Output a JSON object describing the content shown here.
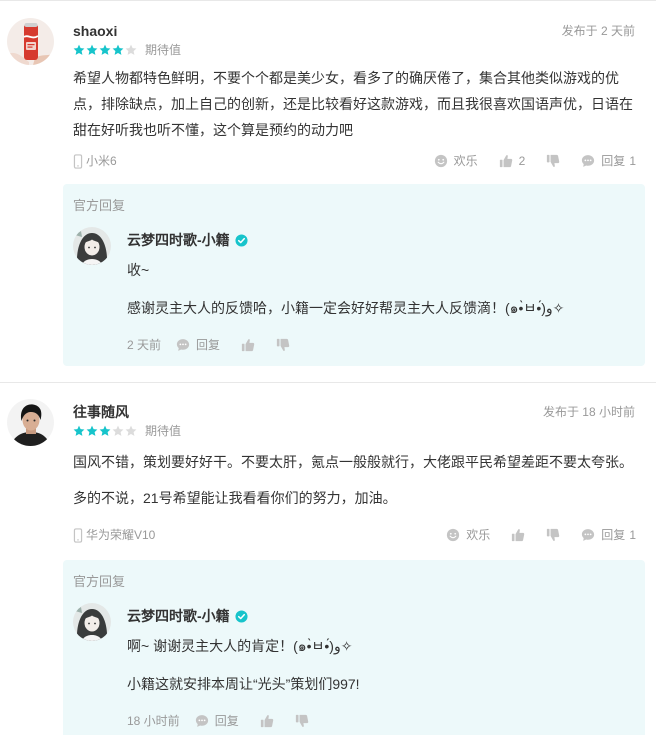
{
  "colors": {
    "accent": "#17c4cb",
    "star_empty": "#dcdcdc",
    "text": "#333333",
    "muted": "#999999",
    "icon": "#c4c4c4",
    "reply_bg": "#edf9fa",
    "divider": "#e8e8e8"
  },
  "icons": {
    "fun": "smile-icon",
    "like": "thumbs-up-icon",
    "dislike": "thumbs-down-icon",
    "reply": "comment-icon",
    "device": "phone-icon",
    "verified": "verified-icon",
    "rating": "star-icon"
  },
  "reviews": [
    {
      "username": "shaoxi",
      "rating": 4,
      "rating_max": 5,
      "rating_label": "期待值",
      "posted": "发布于 2 天前",
      "body": [
        "希望人物都特色鲜明，不要个个都是美少女，看多了的确厌倦了，集合其他类似游戏的优点，排除缺点，加上自己的创新，还是比较看好这款游戏，而且我很喜欢国语声优，日语在甜在好听我也听不懂，这个算是预约的动力吧"
      ],
      "device": "小米6",
      "actions": {
        "fun": "欢乐",
        "likes": "2",
        "reply": "回复",
        "reply_count": "1"
      },
      "official_reply": {
        "header": "官方回复",
        "name": "云梦四时歌-小籍",
        "verified": true,
        "body": [
          "收~",
          "感谢灵主大人的反馈哈，小籍一定会好好帮灵主大人反馈滴！(๑•̀ㅂ•́)و✧"
        ],
        "time": "2 天前",
        "reply": "回复"
      }
    },
    {
      "username": "往事随风",
      "rating": 3,
      "rating_max": 5,
      "rating_label": "期待值",
      "posted": "发布于 18 小时前",
      "body": [
        "国风不错，策划要好好干。不要太肝，氪点一般般就行，大佬跟平民希望差距不要太夸张。",
        "多的不说，21号希望能让我看看你们的努力，加油。"
      ],
      "device": "华为荣耀V10",
      "actions": {
        "fun": "欢乐",
        "reply": "回复",
        "reply_count": "1"
      },
      "official_reply": {
        "header": "官方回复",
        "name": "云梦四时歌-小籍",
        "verified": true,
        "body": [
          "啊~ 谢谢灵主大人的肯定！(๑•̀ㅂ•́)و✧",
          "小籍这就安排本周让“光头”策划们997!"
        ],
        "time": "18 小时前",
        "reply": "回复"
      }
    }
  ]
}
